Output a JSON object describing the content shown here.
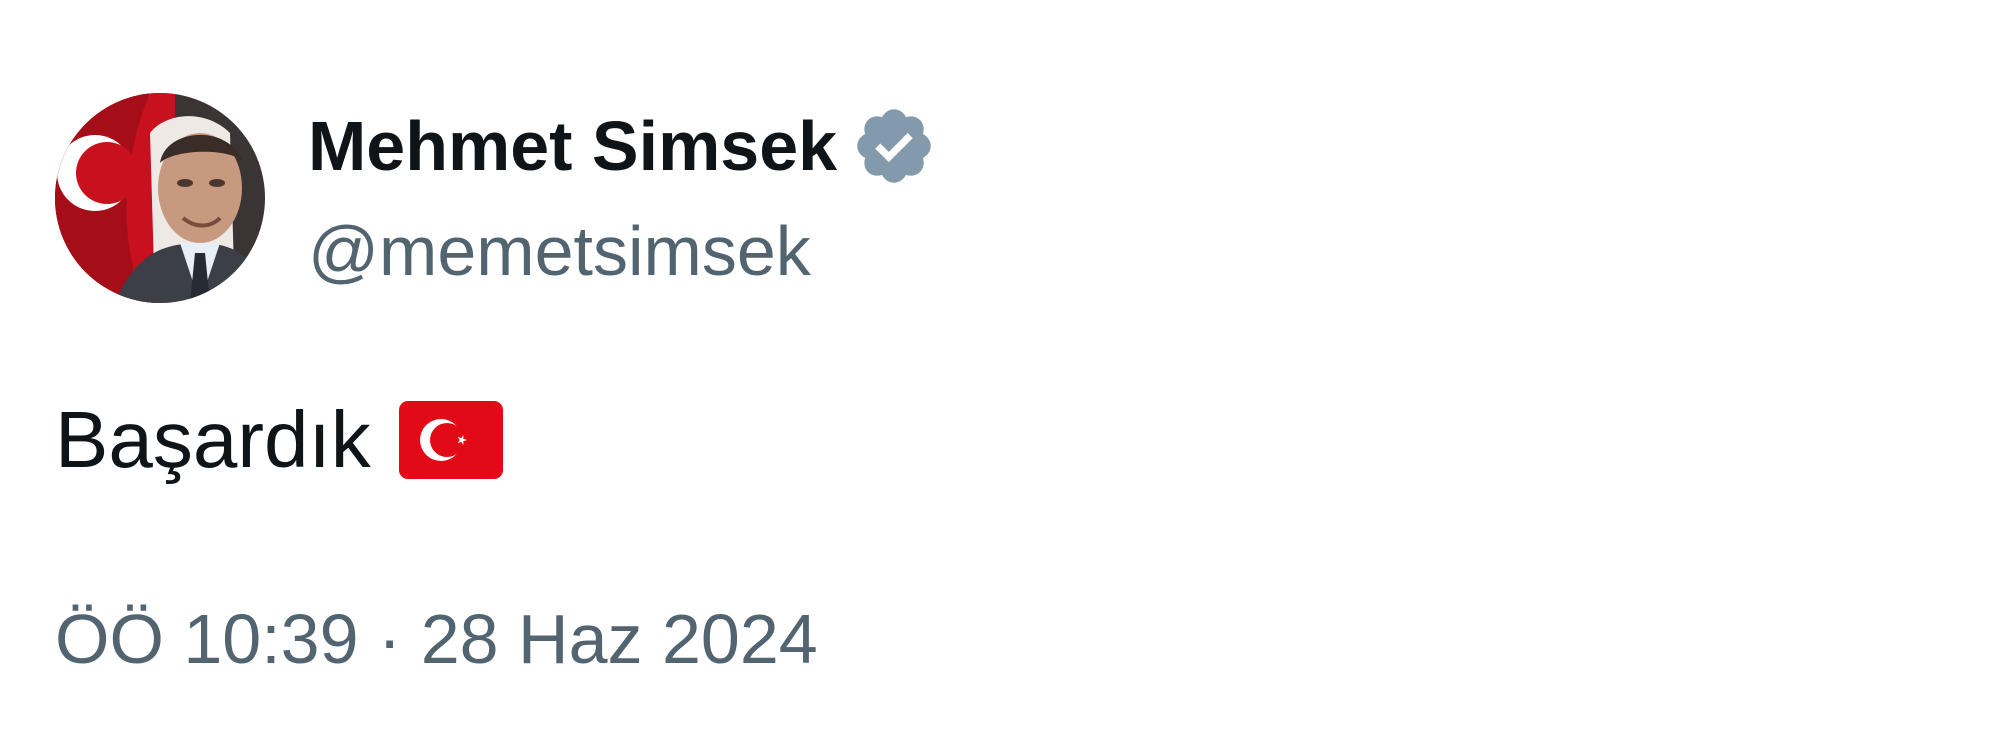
{
  "tweet": {
    "author": {
      "display_name": "Mehmet Simsek",
      "handle": "@memetsimsek",
      "verified_icon": "verified-badge-icon",
      "verified_color": "#829aab",
      "avatar_icon": "profile-avatar"
    },
    "text": "Başardık",
    "emoji": {
      "name": "turkey-flag-emoji",
      "color": "#e30a17"
    },
    "timestamp": "ÖÖ 10:39 · 28 Haz 2024"
  }
}
